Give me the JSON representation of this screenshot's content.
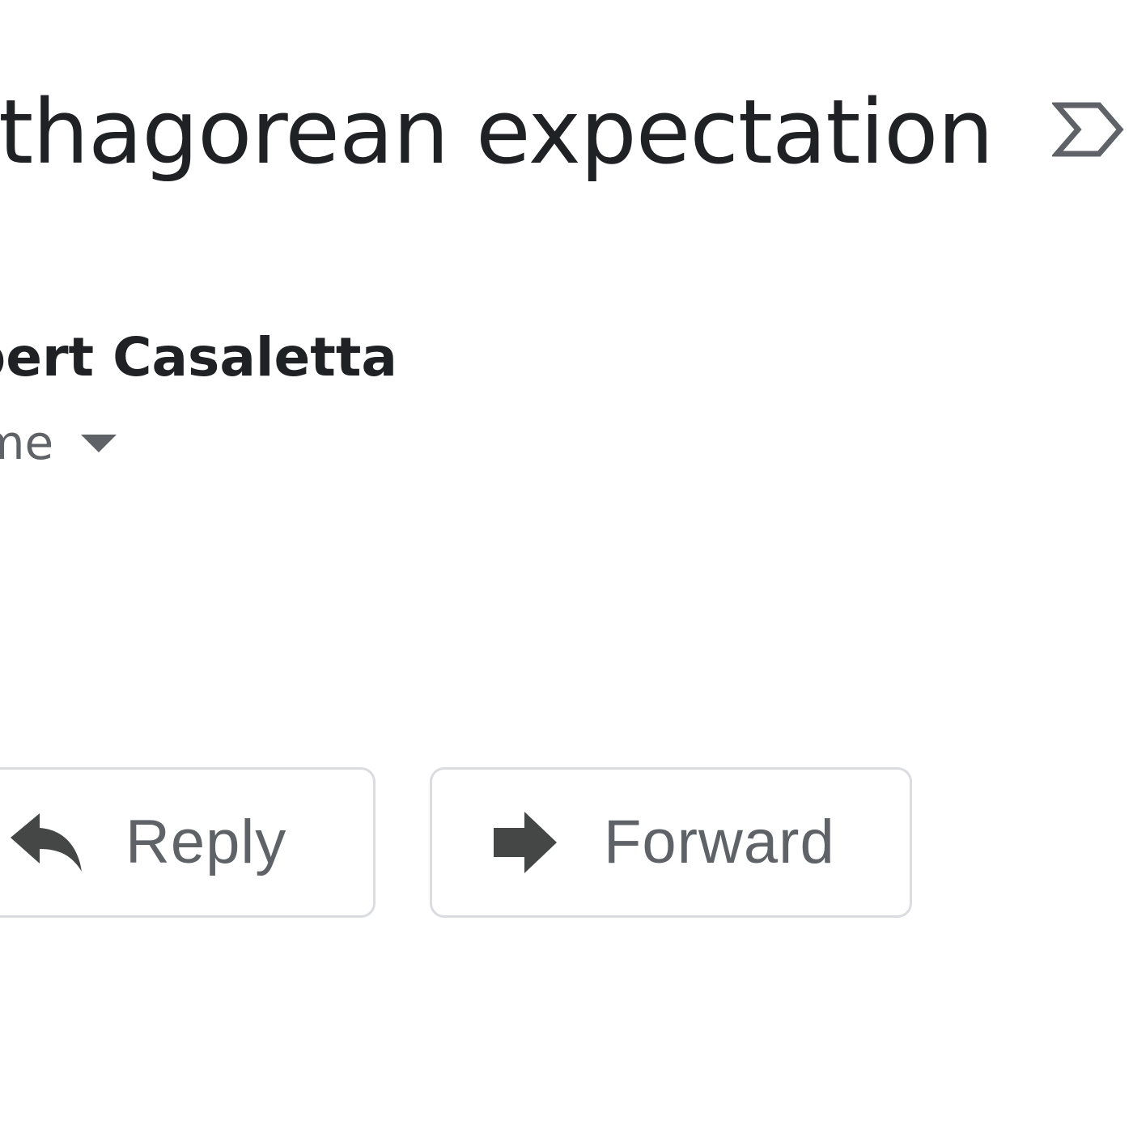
{
  "message": {
    "subject": "ythagorean expectation",
    "sender": "bert Casaletta",
    "recipients": "me"
  },
  "icons": {
    "important": "important-label-outline-icon",
    "details": "caret-down-icon",
    "reply": "reply-arrow-icon",
    "forward": "forward-arrow-icon"
  },
  "actions": {
    "reply_label": "Reply",
    "forward_label": "Forward"
  },
  "colors": {
    "text_primary": "#202124",
    "text_secondary": "#5f6368",
    "icon": "#444746",
    "button_border": "#dadce0",
    "background": "#ffffff"
  }
}
